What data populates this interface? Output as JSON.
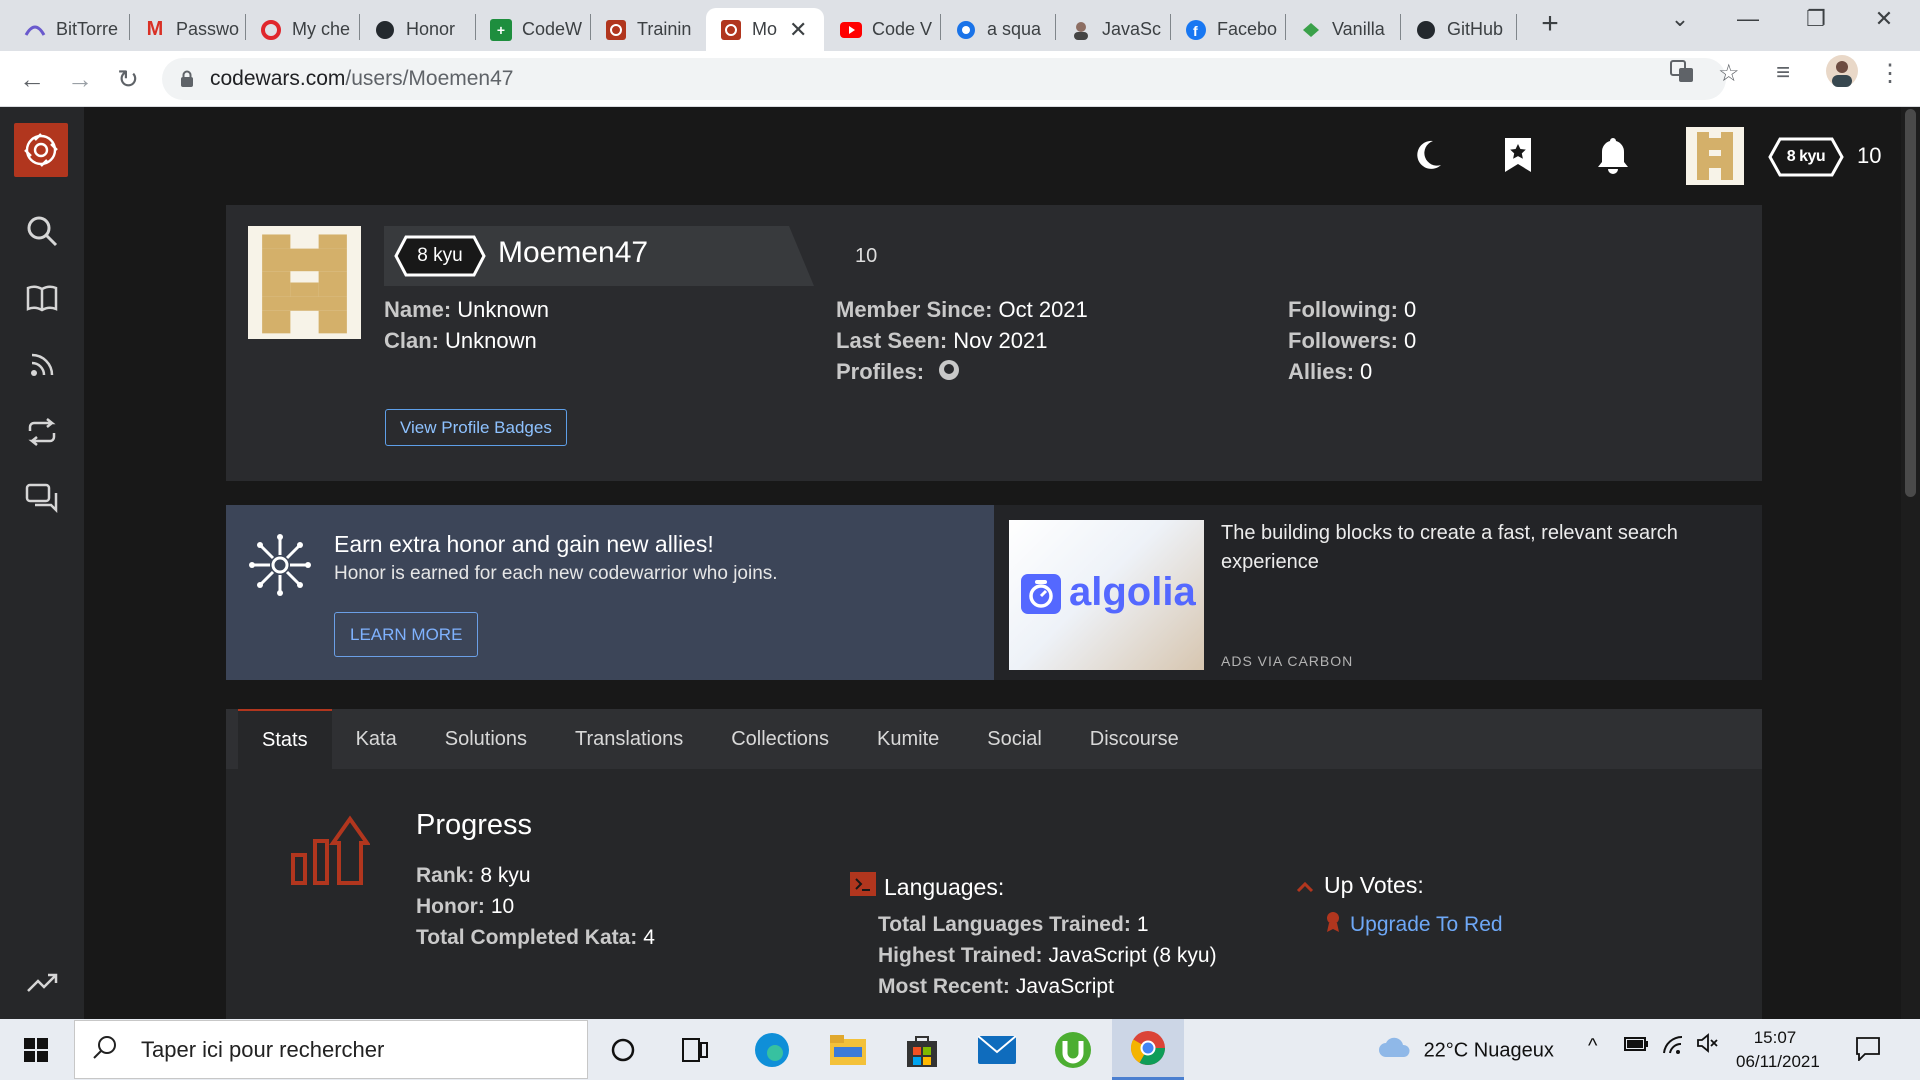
{
  "browser": {
    "tabs": [
      {
        "title": "BitTorre",
        "favicon": "bittorrent-icon"
      },
      {
        "title": "Passwo",
        "favicon": "gmail-icon"
      },
      {
        "title": "My che",
        "favicon": "opera-icon"
      },
      {
        "title": "Honor",
        "favicon": "github-icon"
      },
      {
        "title": "CodeW",
        "favicon": "codewars-plus-icon"
      },
      {
        "title": "Trainin",
        "favicon": "codewars-icon"
      },
      {
        "title": "Mo",
        "favicon": "codewars-icon"
      },
      {
        "title": "Code V",
        "favicon": "youtube-icon"
      },
      {
        "title": "a squa",
        "favicon": "site-icon"
      },
      {
        "title": "JavaSc",
        "favicon": "avatar-icon"
      },
      {
        "title": "Facebo",
        "favicon": "facebook-icon"
      },
      {
        "title": "Vanilla",
        "favicon": "vanilla-icon"
      },
      {
        "title": "GitHub",
        "favicon": "github-icon"
      }
    ],
    "active_tab_close": "✕",
    "url_host": "codewars.com",
    "url_path": "/users/Moemen47"
  },
  "topnav": {
    "rank_badge": "8 kyu",
    "honor": "10"
  },
  "profile": {
    "rank": "8 kyu",
    "username": "Moemen47",
    "honor": "10",
    "name_label": "Name:",
    "name_value": "Unknown",
    "clan_label": "Clan:",
    "clan_value": "Unknown",
    "member_since_label": "Member Since:",
    "member_since_value": "Oct 2021",
    "last_seen_label": "Last Seen:",
    "last_seen_value": "Nov 2021",
    "profiles_label": "Profiles:",
    "following_label": "Following:",
    "following_value": "0",
    "followers_label": "Followers:",
    "followers_value": "0",
    "allies_label": "Allies:",
    "allies_value": "0",
    "badges_button": "View Profile Badges"
  },
  "promo": {
    "title": "Earn extra honor and gain new allies!",
    "text": "Honor is earned for each new codewarrior who joins.",
    "button": "LEARN MORE"
  },
  "ad": {
    "brand": "algolia",
    "text": "The building blocks to create a fast, relevant search experience",
    "via": "ADS VIA CARBON"
  },
  "tabs": [
    "Stats",
    "Kata",
    "Solutions",
    "Translations",
    "Collections",
    "Kumite",
    "Social",
    "Discourse"
  ],
  "stats": {
    "progress_title": "Progress",
    "rank_label": "Rank:",
    "rank_value": "8 kyu",
    "honor_label": "Honor:",
    "honor_value": "10",
    "completed_label": "Total Completed Kata:",
    "completed_value": "4",
    "languages_title": "Languages:",
    "total_lang_label": "Total Languages Trained:",
    "total_lang_value": "1",
    "highest_label": "Highest Trained:",
    "highest_value": "JavaScript (8 kyu)",
    "recent_label": "Most Recent:",
    "recent_value": "JavaScript",
    "upvotes_title": "Up Votes:",
    "upgrade_link": "Upgrade To Red"
  },
  "taskbar": {
    "search_placeholder": "Taper ici pour rechercher",
    "weather": "22°C  Nuageux",
    "time": "15:07",
    "date": "06/11/2021"
  },
  "colors": {
    "brand_red": "#b1361e",
    "link_blue": "#6ea8f7",
    "avatar_gold": "#d4b06a"
  }
}
